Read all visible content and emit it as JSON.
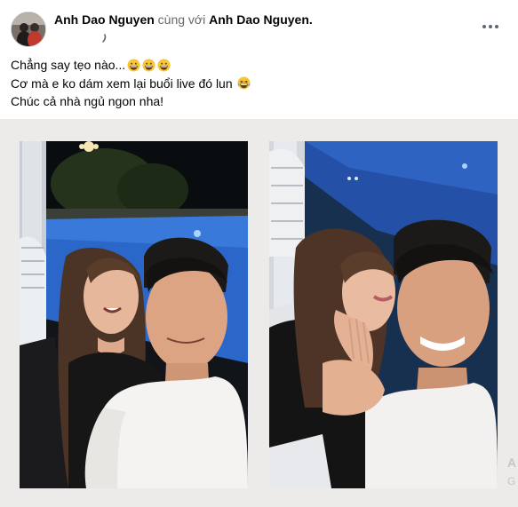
{
  "post": {
    "author": "Anh Dao Nguyen",
    "with_text": "cùng với",
    "tagged": "Anh Dao Nguyen.",
    "lines": [
      "Chẳng say tẹo nào...",
      "Cơ mà e ko dám xem lại buổi live đó lun",
      "Chúc cả nhà ngủ ngon nha!"
    ]
  },
  "icons": {
    "privacy": "globe-icon",
    "more": "more-options-icon",
    "emoji_grin": "grinning-emoji",
    "emoji_laugh": "laughing-emoji"
  },
  "colors": {
    "text": "#050505",
    "secondary": "#65676b",
    "photo_bg": "#ecebe9",
    "pool": "#2b67c9"
  }
}
